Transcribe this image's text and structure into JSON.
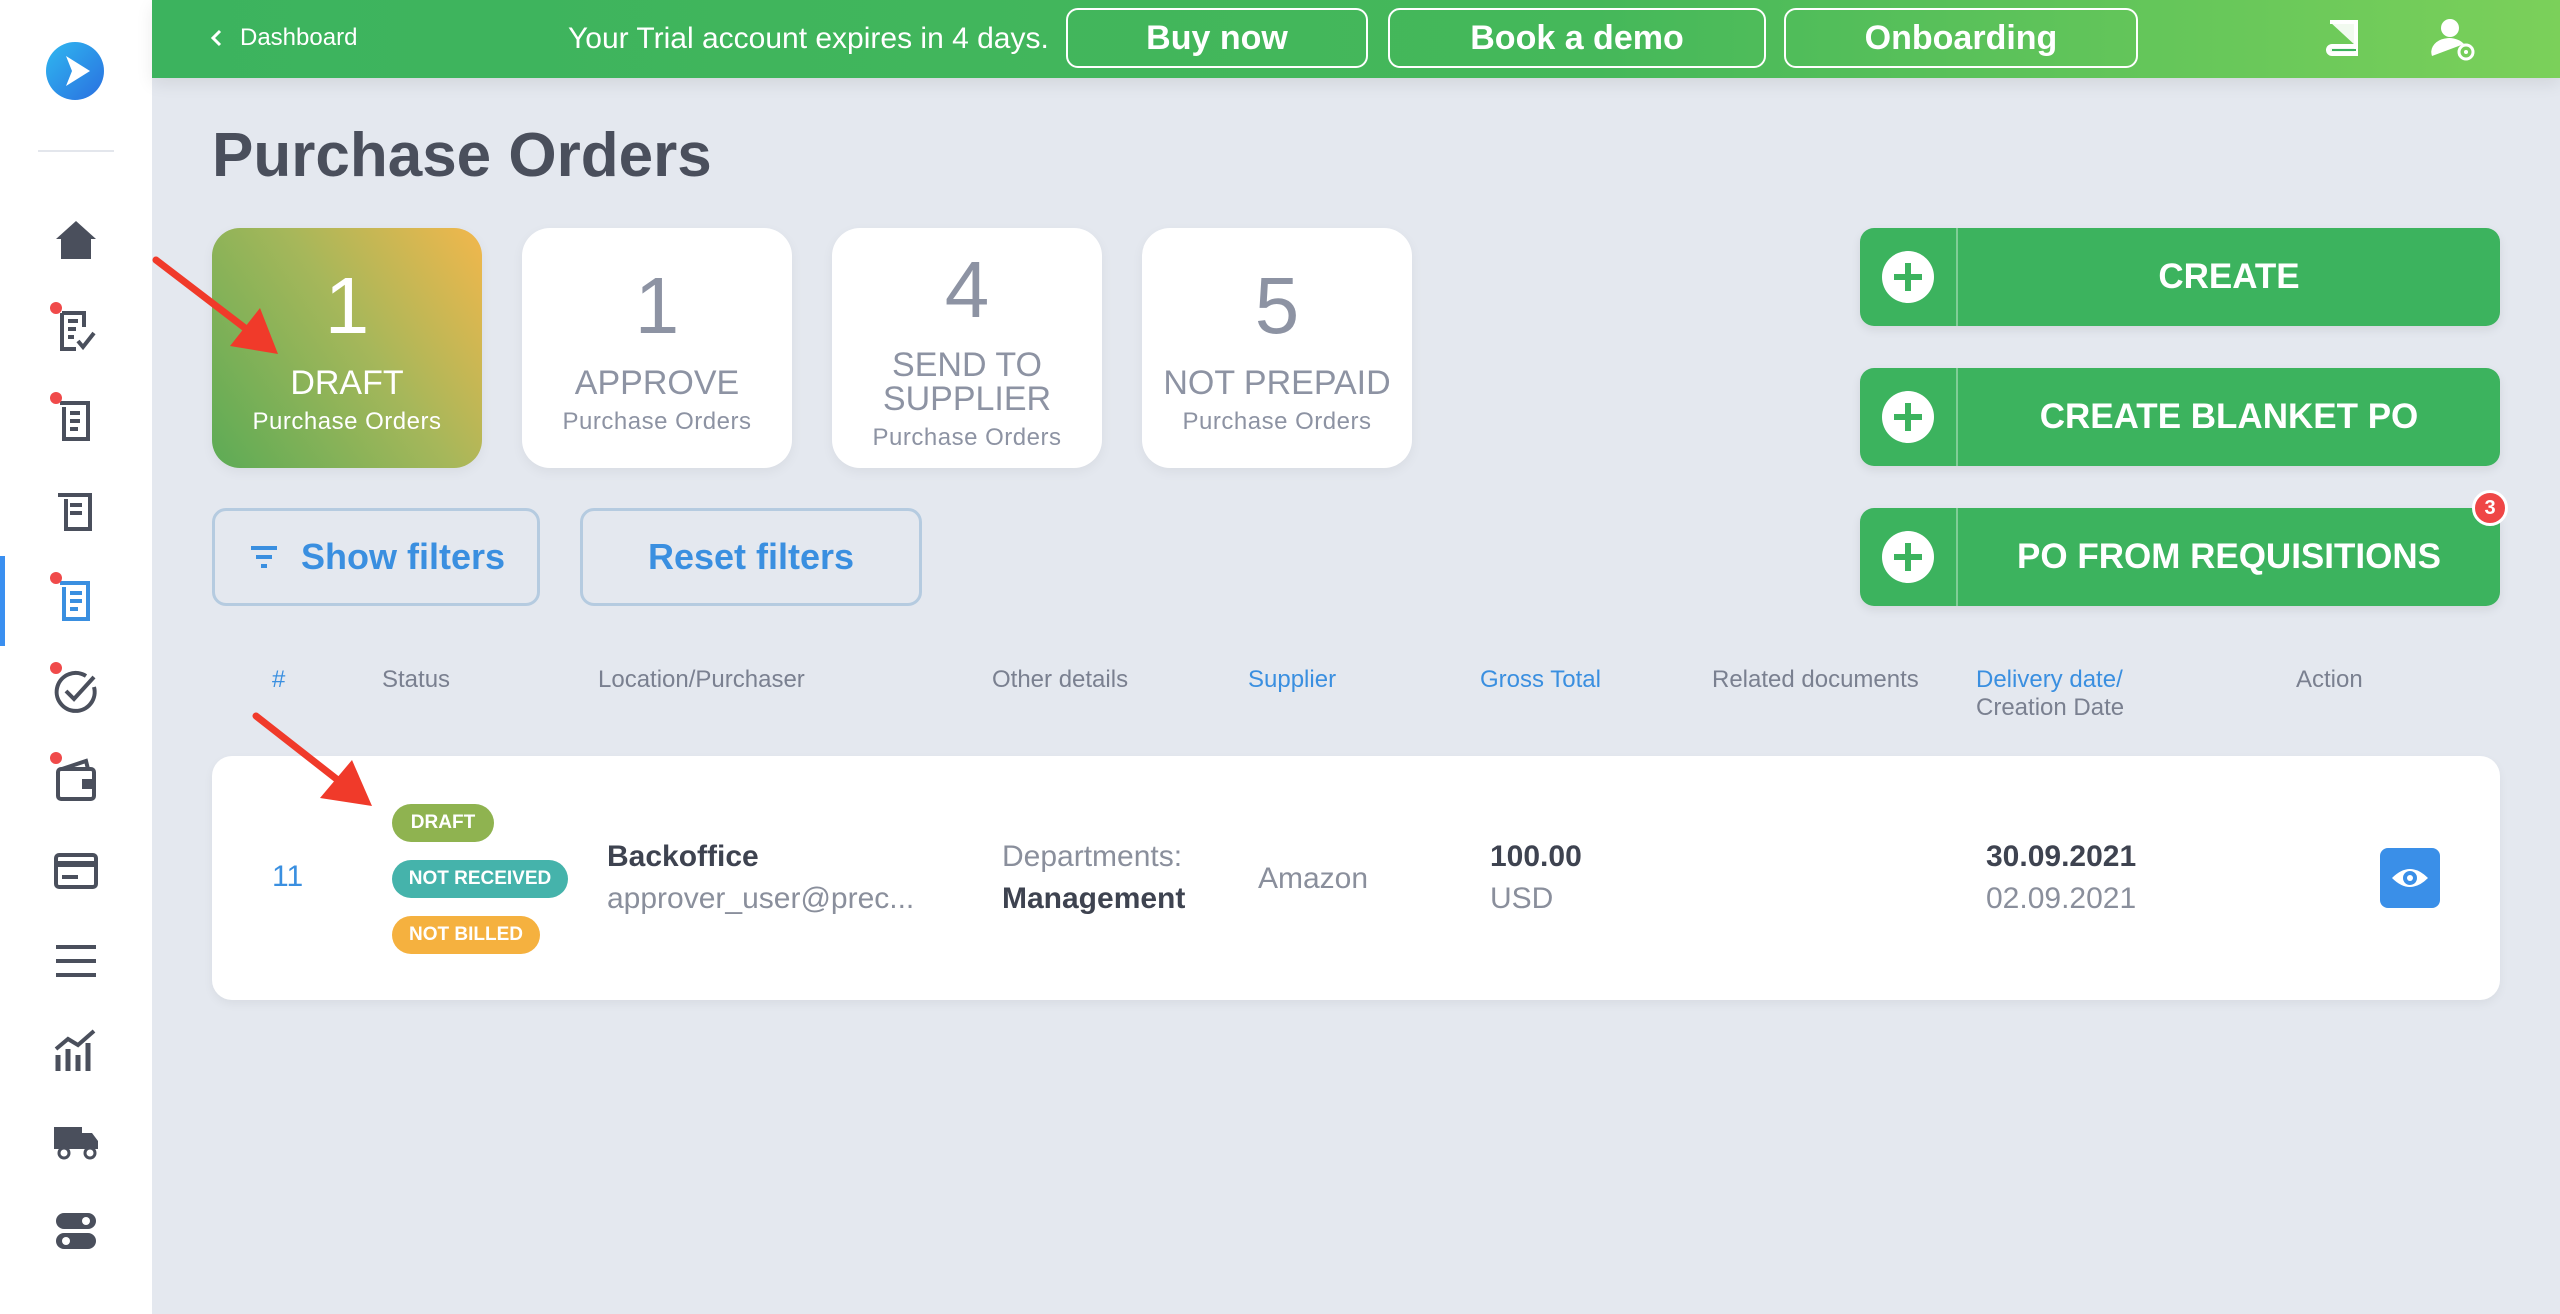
{
  "topbar": {
    "back_label": "Dashboard",
    "trial_text": "Your Trial account expires in 4 days.",
    "buy_now": "Buy now",
    "book_demo": "Book a demo",
    "onboarding": "Onboarding"
  },
  "page": {
    "title": "Purchase Orders"
  },
  "cards": [
    {
      "count": "1",
      "label": "DRAFT",
      "sub": "Purchase Orders"
    },
    {
      "count": "1",
      "label": "APPROVE",
      "sub": "Purchase Orders"
    },
    {
      "count": "4",
      "label_line1": "SEND TO",
      "label_line2": "SUPPLIER",
      "sub": "Purchase Orders"
    },
    {
      "count": "5",
      "label": "NOT PREPAID",
      "sub": "Purchase Orders"
    }
  ],
  "actions": {
    "create": "CREATE",
    "create_blanket": "CREATE BLANKET PO",
    "po_from_requisitions": "PO FROM REQUISITIONS",
    "requisitions_count": "3"
  },
  "filters": {
    "show": "Show filters",
    "reset": "Reset filters"
  },
  "table": {
    "headers": {
      "number": "#",
      "status": "Status",
      "location": "Location/Purchaser",
      "other": "Other details",
      "supplier": "Supplier",
      "gross": "Gross Total",
      "related": "Related documents",
      "delivery": "Delivery date/",
      "creation": "Creation Date",
      "action": "Action"
    },
    "rows": [
      {
        "number": "11",
        "tags": [
          "DRAFT",
          "NOT RECEIVED",
          "NOT BILLED"
        ],
        "location": "Backoffice",
        "purchaser": "approver_user@prec...",
        "departments_label": "Departments:",
        "departments_value": "Management",
        "supplier": "Amazon",
        "gross_total": "100.00",
        "currency": "USD",
        "delivery_date": "30.09.2021",
        "creation_date": "02.09.2021"
      }
    ]
  },
  "colors": {
    "green": "#3cb35e",
    "blue": "#3a8fe0",
    "tag_draft": "#8fb350",
    "tag_not_received": "#45b3ab",
    "tag_not_billed": "#f5b13f",
    "annotation_arrow": "#f03a2a"
  }
}
